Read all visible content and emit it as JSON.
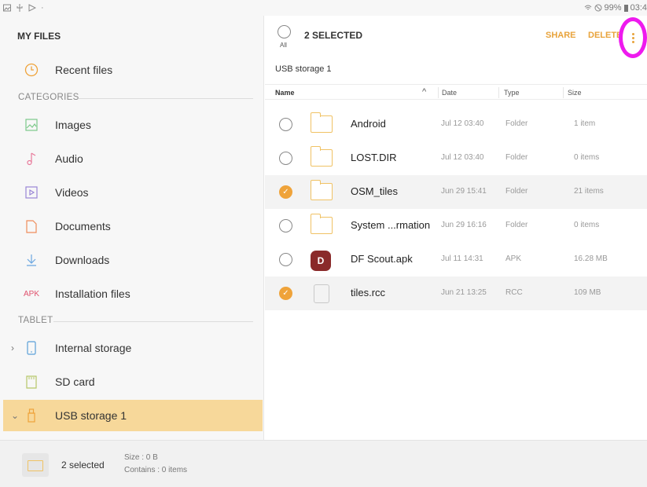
{
  "status_bar": {
    "right_text": "99%",
    "time": "03:4"
  },
  "left_pane": {
    "title": "MY FILES",
    "recent_label": "Recent files",
    "categories_heading": "CATEGORIES",
    "categories": [
      {
        "label": "Images",
        "icon": "image-icon"
      },
      {
        "label": "Audio",
        "icon": "music-note-icon"
      },
      {
        "label": "Videos",
        "icon": "video-icon"
      },
      {
        "label": "Documents",
        "icon": "document-icon"
      },
      {
        "label": "Downloads",
        "icon": "download-icon"
      },
      {
        "label": "Installation files",
        "icon": "apk-icon",
        "icon_text": "APK"
      }
    ],
    "tablet_heading": "TABLET",
    "storage": [
      {
        "label": "Internal storage",
        "icon": "phone-icon"
      },
      {
        "label": "SD card",
        "icon": "sd-card-icon"
      },
      {
        "label": "USB storage 1",
        "icon": "usb-icon",
        "active": true
      }
    ]
  },
  "toolbar": {
    "all_label": "All",
    "selected_title": "2 SELECTED",
    "share_label": "SHARE",
    "delete_label": "DELETE",
    "accent_color": "#e8a33b"
  },
  "path": "USB storage 1",
  "columns": {
    "name": "Name",
    "date": "Date",
    "type": "Type",
    "size": "Size"
  },
  "files": [
    {
      "name": "Android",
      "date": "Jul 12 03:40",
      "type": "Folder",
      "size": "1 item",
      "checked": false,
      "icon": "folder-icon"
    },
    {
      "name": "LOST.DIR",
      "date": "Jul 12 03:40",
      "type": "Folder",
      "size": "0 items",
      "checked": false,
      "icon": "folder-icon"
    },
    {
      "name": "OSM_tiles",
      "date": "Jun 29 15:41",
      "type": "Folder",
      "size": "21 items",
      "checked": true,
      "icon": "folder-icon"
    },
    {
      "name": "System ...rmation",
      "date": "Jun 29 16:16",
      "type": "Folder",
      "size": "0 items",
      "checked": false,
      "icon": "folder-icon"
    },
    {
      "name": "DF Scout.apk",
      "date": "Jul 11 14:31",
      "type": "APK",
      "size": "16.28 MB",
      "checked": false,
      "icon": "app-icon"
    },
    {
      "name": "tiles.rcc",
      "date": "Jun 21 13:25",
      "type": "RCC",
      "size": "109 MB",
      "checked": true,
      "icon": "file-icon"
    }
  ],
  "bottom_bar": {
    "selected_text": "2 selected",
    "size_text": "Size : 0 B",
    "contains_text": "Contains : 0 items"
  }
}
